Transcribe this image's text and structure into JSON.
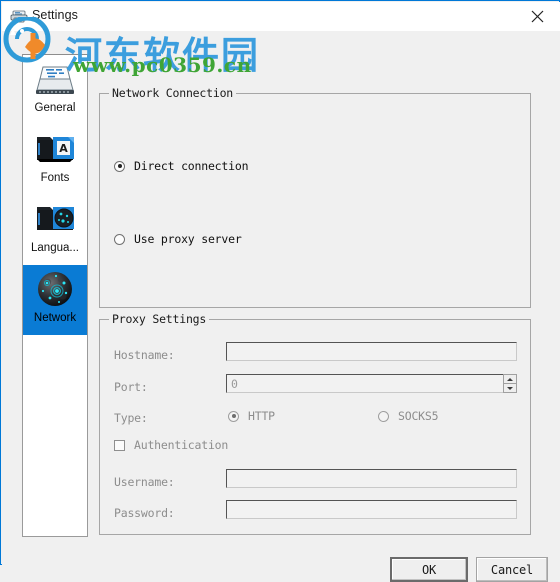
{
  "window": {
    "title": "Settings",
    "icon": "printer-icon",
    "close_label": "✕",
    "border_color": "#0078d7",
    "titlebar_bg": "#ffffff",
    "client_bg": "#f0f0f0"
  },
  "sidebar": {
    "items": [
      {
        "label": "General",
        "icon": "scanner-icon",
        "selected": false
      },
      {
        "label": "Fonts",
        "icon": "folder-font-icon",
        "selected": false
      },
      {
        "label": "Langua...",
        "icon": "folder-globe-icon",
        "selected": false
      },
      {
        "label": "Network",
        "icon": "network-globe-icon",
        "selected": true
      }
    ],
    "selected_color": "#0a7bd4"
  },
  "network_group": {
    "title": "Network Connection",
    "options": [
      {
        "label": "Direct connection",
        "checked": true,
        "disabled": false
      },
      {
        "label": "Use proxy server",
        "checked": false,
        "disabled": false
      }
    ]
  },
  "proxy_group": {
    "title": "Proxy Settings",
    "disabled": true,
    "hostname": {
      "label": "Hostname:",
      "value": "",
      "placeholder": ""
    },
    "port": {
      "label": "Port:",
      "value": "0",
      "spinner": true
    },
    "type": {
      "label": "Type:",
      "options": [
        {
          "label": "HTTP",
          "checked": true,
          "disabled": true
        },
        {
          "label": "SOCKS5",
          "checked": false,
          "disabled": true
        }
      ]
    },
    "authentication": {
      "label": "Authentication",
      "checked": false,
      "disabled": true
    },
    "username": {
      "label": "Username:",
      "value": ""
    },
    "password": {
      "label": "Password:",
      "value": ""
    }
  },
  "footer": {
    "ok_label": "OK",
    "cancel_label": "Cancel"
  },
  "watermark": {
    "chinese": "河东软件园",
    "url": "www.pc0359.cn",
    "cn_color": "#3c9ede",
    "url_color": "#3fa535"
  }
}
